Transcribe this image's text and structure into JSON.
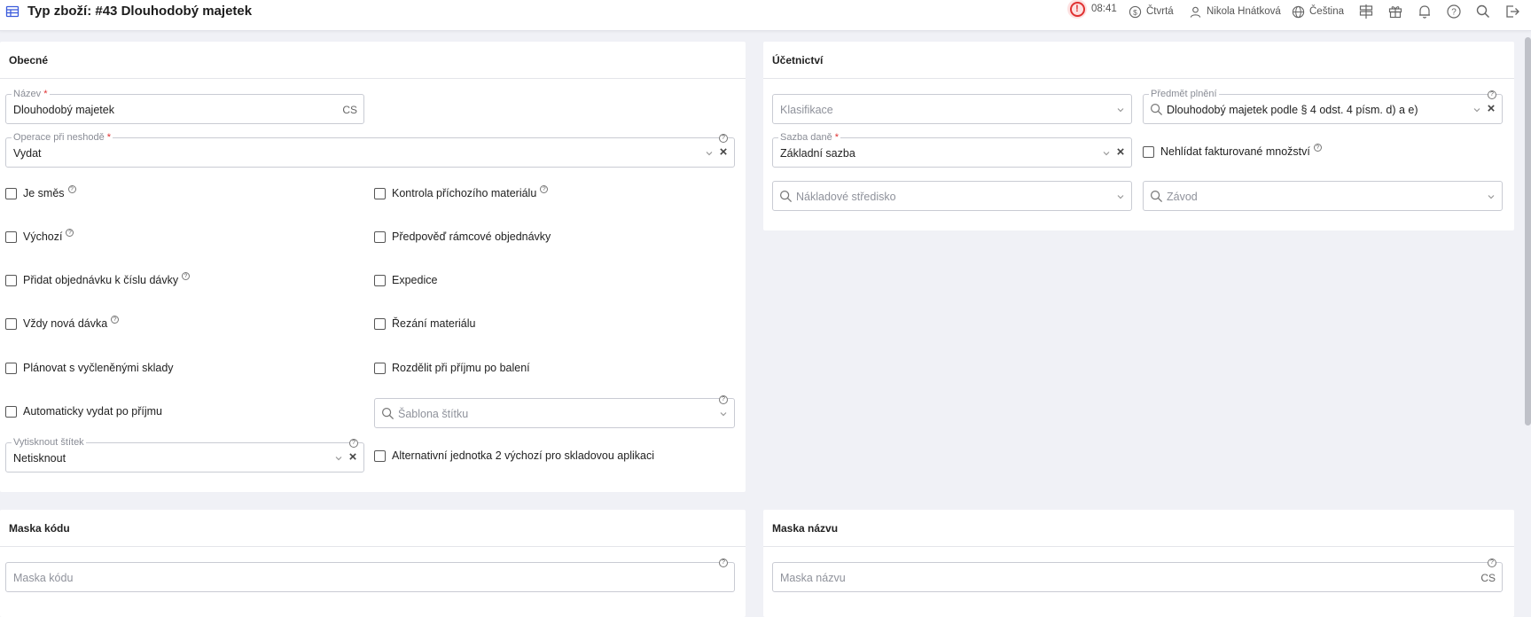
{
  "header": {
    "title": "Typ zboží: #43 Dlouhodobý majetek",
    "time": "08:41",
    "company": "Čtvrtá",
    "user": "Nikola Hnátková",
    "language": "Čeština"
  },
  "general": {
    "heading": "Obecné",
    "name_label": "Název",
    "name_value": "Dlouhodobý majetek",
    "name_lang": "CS",
    "mismatch_label": "Operace při neshodě",
    "mismatch_value": "Vydat",
    "checks_left": [
      {
        "label": "Je směs",
        "hint": true
      },
      {
        "label": "Výchozí",
        "hint": true
      },
      {
        "label": "Přidat objednávku k číslu dávky",
        "hint": true
      },
      {
        "label": "Vždy nová dávka",
        "hint": true
      },
      {
        "label": "Plánovat s vyčleněnými sklady",
        "hint": false
      },
      {
        "label": "Automaticky vydat po příjmu",
        "hint": false
      }
    ],
    "checks_right": [
      {
        "label": "Kontrola příchozího materiálu",
        "hint": true
      },
      {
        "label": "Předpověď rámcové objednávky",
        "hint": false
      },
      {
        "label": "Expedice",
        "hint": false
      },
      {
        "label": "Řezání materiálu",
        "hint": false
      },
      {
        "label": "Rozdělit při příjmu po balení",
        "hint": false
      }
    ],
    "label_template_placeholder": "Šablona štítku",
    "print_label_label": "Vytisknout štítek",
    "print_label_value": "Netisknout",
    "alt_unit_label": "Alternativní jednotka 2 výchozí pro skladovou aplikaci"
  },
  "accounting": {
    "heading": "Účetnictví",
    "classification_placeholder": "Klasifikace",
    "subject_label": "Předmět plnění",
    "subject_value": "Dlouhodobý majetek podle § 4 odst. 4 písm. d) a e)",
    "tax_label": "Sazba daně",
    "tax_value": "Základní sazba",
    "no_watch_label": "Nehlídat fakturované množství",
    "cost_center_placeholder": "Nákladové středisko",
    "plant_placeholder": "Závod"
  },
  "code_mask": {
    "heading": "Maska kódu",
    "placeholder": "Maska kódu"
  },
  "name_mask": {
    "heading": "Maska názvu",
    "placeholder": "Maska názvu",
    "lang": "CS"
  },
  "colors": {
    "accent": "#3b5bdb",
    "required": "#e03131",
    "background": "#f0f1f6"
  }
}
